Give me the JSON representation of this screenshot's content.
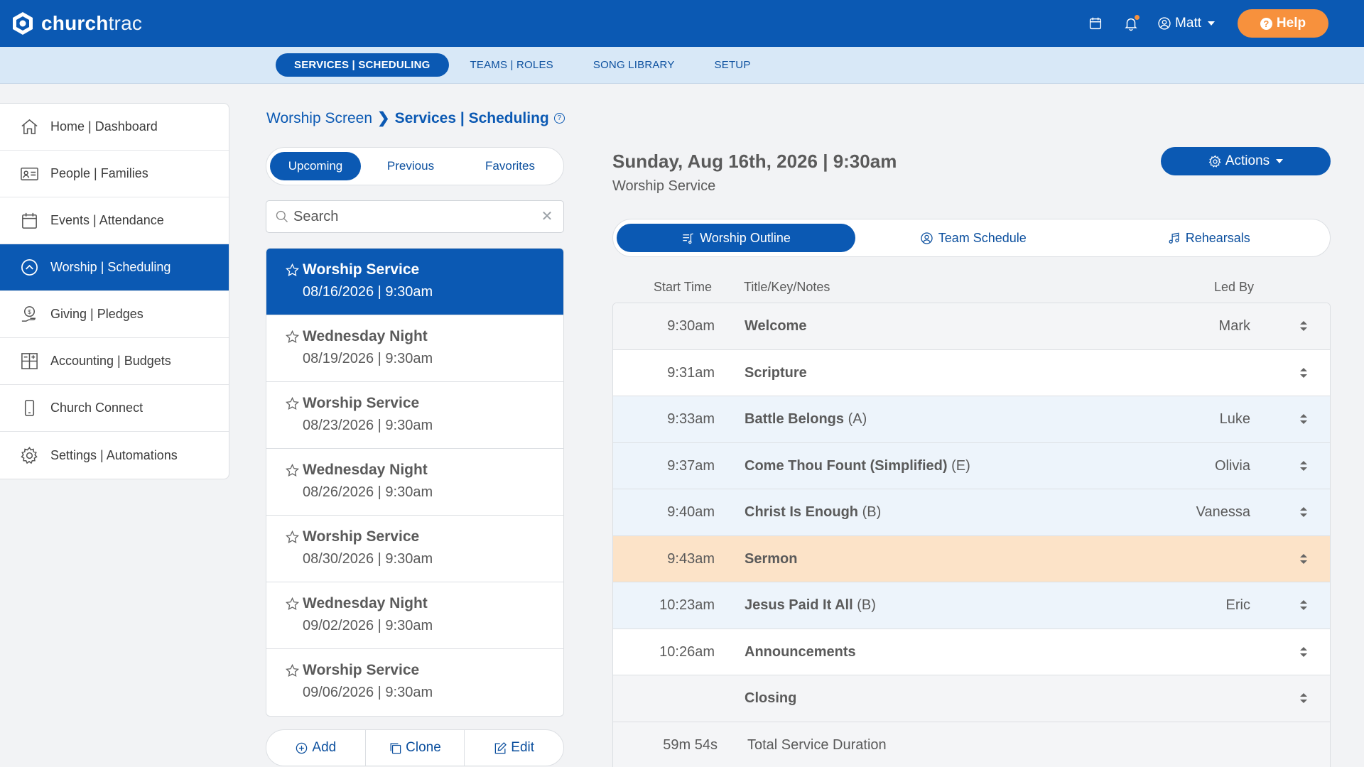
{
  "app": {
    "logo_bold": "church",
    "logo_light": "trac",
    "user_name": "Matt",
    "help_label": "Help",
    "accent": "#0b59b3",
    "help_color": "#f7913d"
  },
  "subnav": {
    "tabs": [
      {
        "label": "SERVICES | SCHEDULING"
      },
      {
        "label": "TEAMS | ROLES"
      },
      {
        "label": "SONG LIBRARY"
      },
      {
        "label": "SETUP"
      }
    ]
  },
  "sidebar": {
    "items": [
      {
        "label": "Home | Dashboard",
        "icon": "home-icon"
      },
      {
        "label": "People | Families",
        "icon": "id-card-icon"
      },
      {
        "label": "Events | Attendance",
        "icon": "calendar-icon"
      },
      {
        "label": "Worship | Scheduling",
        "icon": "chevron-circle-icon"
      },
      {
        "label": "Giving | Pledges",
        "icon": "money-hand-icon"
      },
      {
        "label": "Accounting | Budgets",
        "icon": "grid-icon"
      },
      {
        "label": "Church Connect",
        "icon": "phone-icon"
      },
      {
        "label": "Settings | Automations",
        "icon": "gear-icon"
      }
    ]
  },
  "breadcrumb": {
    "root": "Worship Screen",
    "current": "Services | Scheduling"
  },
  "filters": {
    "tabs": [
      {
        "label": "Upcoming"
      },
      {
        "label": "Previous"
      },
      {
        "label": "Favorites"
      }
    ]
  },
  "search": {
    "placeholder": "Search"
  },
  "services": [
    {
      "name": "Worship Service",
      "date": "08/16/2026 | 9:30am"
    },
    {
      "name": "Wednesday Night",
      "date": "08/19/2026 | 9:30am"
    },
    {
      "name": "Worship Service",
      "date": "08/23/2026 | 9:30am"
    },
    {
      "name": "Wednesday Night",
      "date": "08/26/2026 | 9:30am"
    },
    {
      "name": "Worship Service",
      "date": "08/30/2026 | 9:30am"
    },
    {
      "name": "Wednesday Night",
      "date": "09/02/2026 | 9:30am"
    },
    {
      "name": "Worship Service",
      "date": "09/06/2026 | 9:30am"
    }
  ],
  "list_actions": {
    "add": "Add",
    "clone": "Clone",
    "edit": "Edit"
  },
  "detail": {
    "title": "Sunday, Aug 16th, 2026 | 9:30am",
    "subtitle": "Worship Service",
    "actions_label": "Actions",
    "tabs": [
      {
        "label": "Worship Outline"
      },
      {
        "label": "Team Schedule"
      },
      {
        "label": "Rehearsals"
      }
    ],
    "columns": {
      "start_time": "Start Time",
      "title": "Title/Key/Notes",
      "led_by": "Led By"
    },
    "rows": [
      {
        "time": "9:30am",
        "title": "Welcome",
        "key": "",
        "led": "Mark"
      },
      {
        "time": "9:31am",
        "title": "Scripture",
        "key": "",
        "led": ""
      },
      {
        "time": "9:33am",
        "title": "Battle Belongs",
        "key": "(A)",
        "led": "Luke"
      },
      {
        "time": "9:37am",
        "title": "Come Thou Fount (Simplified)",
        "key": "(E)",
        "led": "Olivia"
      },
      {
        "time": "9:40am",
        "title": "Christ Is Enough",
        "key": "(B)",
        "led": "Vanessa"
      },
      {
        "time": "9:43am",
        "title": "Sermon",
        "key": "",
        "led": ""
      },
      {
        "time": "10:23am",
        "title": "Jesus Paid It All",
        "key": "(B)",
        "led": "Eric"
      },
      {
        "time": "10:26am",
        "title": "Announcements",
        "key": "",
        "led": ""
      },
      {
        "time": "",
        "title": "Closing",
        "key": "",
        "led": ""
      }
    ],
    "total": {
      "duration": "59m 54s",
      "label": "Total Service Duration"
    }
  }
}
